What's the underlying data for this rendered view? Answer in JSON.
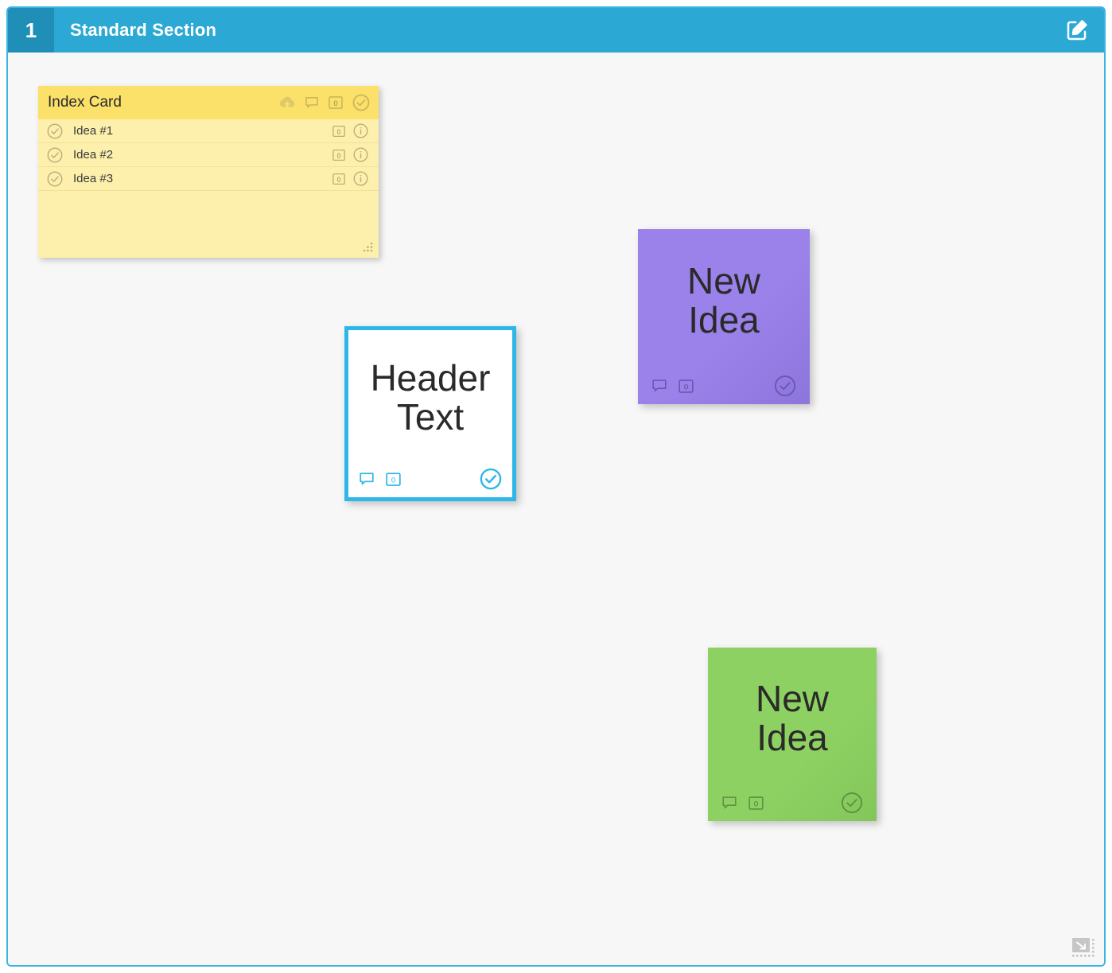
{
  "section": {
    "number": "1",
    "title": "Standard Section",
    "edit_icon": "edit-square-pencil-icon",
    "header_bg": "#2ba9d4",
    "number_bg": "#1f8fb8",
    "border_color": "#3cb4e0",
    "canvas_bg": "#f7f7f7"
  },
  "index_card": {
    "title": "Index Card",
    "header_bg": "#fbe06a",
    "body_bg": "#fdf0ac",
    "header_icons": [
      {
        "name": "cloud-download-icon",
        "label": ""
      },
      {
        "name": "comment-icon",
        "label": ""
      },
      {
        "name": "attachment-count-icon",
        "label": "0"
      },
      {
        "name": "check-circle-icon",
        "label": ""
      }
    ],
    "rows": [
      {
        "label": "Idea #1",
        "count": "0"
      },
      {
        "label": "Idea #2",
        "count": "0"
      },
      {
        "label": "Idea #3",
        "count": "0"
      }
    ],
    "resize_grip": "resize-grip-icon"
  },
  "notes": {
    "purple": {
      "text": "New\nIdea",
      "color": "#9b82ea",
      "comment_icon": "comment-icon",
      "count": "0",
      "check_icon": "check-circle-icon"
    },
    "white": {
      "text": "Header\nText",
      "color": "#ffffff",
      "border_color": "#2fb6e8",
      "comment_icon": "comment-icon",
      "count": "0",
      "check_icon": "check-circle-icon"
    },
    "green": {
      "text": "New\nIdea",
      "color": "#8ed163",
      "comment_icon": "comment-icon",
      "count": "0",
      "check_icon": "check-circle-icon"
    }
  },
  "canvas": {
    "resize_handle": "canvas-resize-handle-icon"
  }
}
